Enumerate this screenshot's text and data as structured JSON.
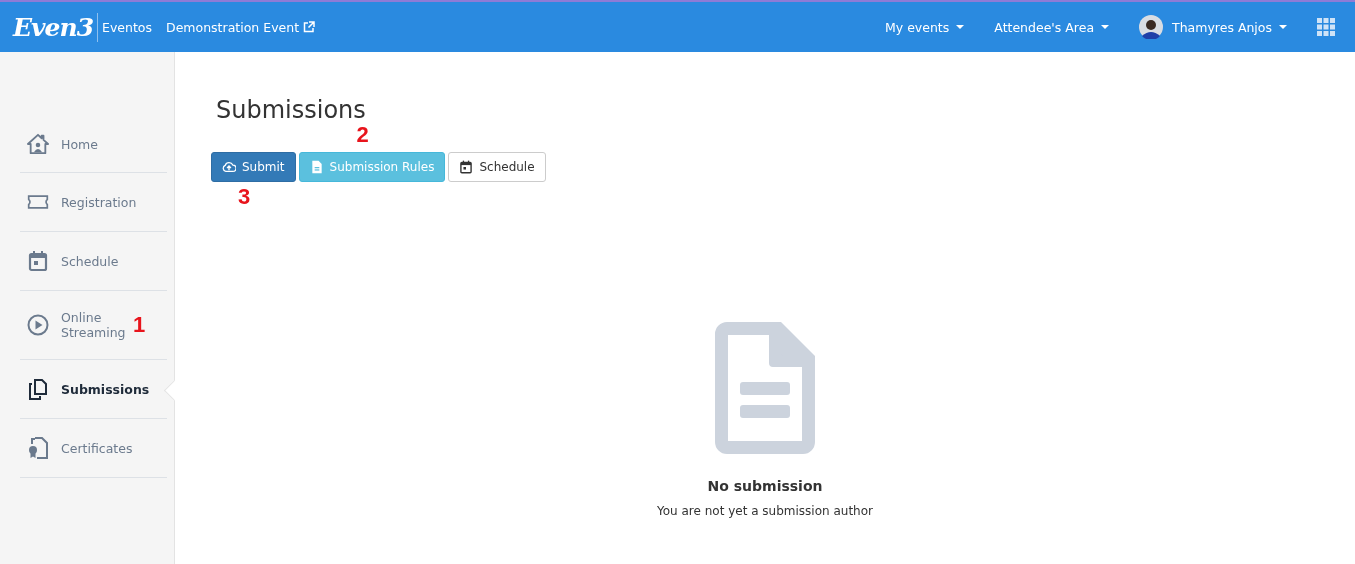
{
  "topbar": {
    "logo": "Even3",
    "product": "Eventos",
    "event_link": "Demonstration Event",
    "menus": [
      {
        "label": "My events"
      },
      {
        "label": "Attendee's Area"
      }
    ],
    "user": {
      "name": "Thamyres Anjos"
    }
  },
  "sidebar": {
    "items": [
      {
        "label": "Home",
        "selected": false
      },
      {
        "label": "Registration",
        "selected": false
      },
      {
        "label": "Schedule",
        "selected": false
      },
      {
        "label": "Online Streaming",
        "selected": false,
        "callout": "1"
      },
      {
        "label": "Submissions",
        "selected": true
      },
      {
        "label": "Certificates",
        "selected": false
      }
    ]
  },
  "main": {
    "title": "Submissions",
    "buttons": [
      {
        "label": "Submit",
        "kind": "primary",
        "callout": "3"
      },
      {
        "label": "Submission Rules",
        "kind": "info",
        "callout": "2"
      },
      {
        "label": "Schedule",
        "kind": "default"
      }
    ],
    "empty_state": {
      "title": "No submission",
      "message": "You are not yet a submission author"
    }
  }
}
